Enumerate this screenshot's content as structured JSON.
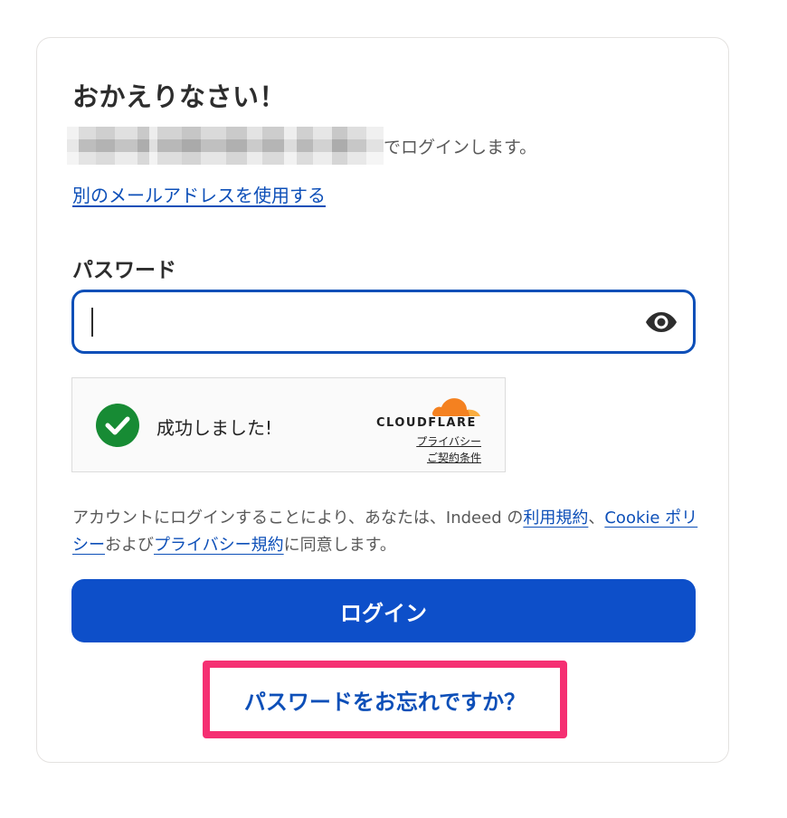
{
  "header": {
    "title": "おかえりなさい！"
  },
  "account": {
    "login_as_suffix": "でログインします。",
    "alt_email_link": "別のメールアドレスを使用する"
  },
  "password": {
    "label": "パスワード",
    "value": "",
    "toggle_icon": "eye-icon"
  },
  "captcha": {
    "status_text": "成功しました!",
    "provider": "CLOUDFLARE",
    "privacy_link": "プライバシー",
    "terms_link": "ご契約条件",
    "status_icon": "checkmark-circle-icon",
    "colors": {
      "success": "#178b34",
      "cloudflare_orange": "#f48120"
    }
  },
  "legal": {
    "prefix": "アカウントにログインすることにより、あなたは、Indeed の",
    "terms_link": "利用規約",
    "comma": "、",
    "cookie_link": "Cookie ポリシー",
    "and": "および",
    "privacy_link": "プライバシー規約",
    "suffix": "に同意します。"
  },
  "actions": {
    "login_button": "ログイン",
    "forgot_password_link": "パスワードをお忘れですか？"
  },
  "colors": {
    "primary": "#0d4fc9",
    "highlight_border": "#f52f72"
  }
}
